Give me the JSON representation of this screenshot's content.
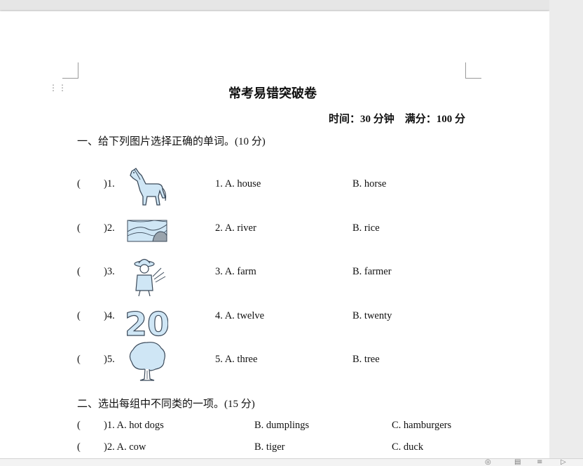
{
  "document": {
    "title": "常考易错突破卷",
    "meta": "时间：30 分钟　满分：100 分",
    "section1": "一、给下列图片选择正确的单词。(10 分)",
    "section2": "二、选出每组中不同类的一项。(15 分)"
  },
  "part1": [
    {
      "paren_l": "(",
      "num": ")1.",
      "a": "1. A. house",
      "b": "B. horse",
      "icon": "horse-icon"
    },
    {
      "paren_l": "(",
      "num": ")2.",
      "a": "2. A. river",
      "b": "B. rice",
      "icon": "river-icon"
    },
    {
      "paren_l": "(",
      "num": ")3.",
      "a": "3. A. farm",
      "b": "B. farmer",
      "icon": "farmer-icon"
    },
    {
      "paren_l": "(",
      "num": ")4.",
      "a": "4. A. twelve",
      "b": "B. twenty",
      "icon": "number-twenty-icon"
    },
    {
      "paren_l": "(",
      "num": ")5.",
      "a": "5. A. three",
      "b": "B. tree",
      "icon": "tree-icon"
    }
  ],
  "part2": [
    {
      "paren_l": "(",
      "num_a": ")1. A. hot dogs",
      "b": "B. dumplings",
      "c": "C. hamburgers"
    },
    {
      "paren_l": "(",
      "num_a": ")2. A. cow",
      "b": "B. tiger",
      "c": "C. duck"
    }
  ],
  "pictures": {
    "picture_4_text": "20"
  },
  "colors": {
    "page": "#ffffff",
    "background": "#e6e6e6",
    "illustration_fill": "#cfe6f5",
    "illustration_stroke": "#3b4a5a"
  }
}
